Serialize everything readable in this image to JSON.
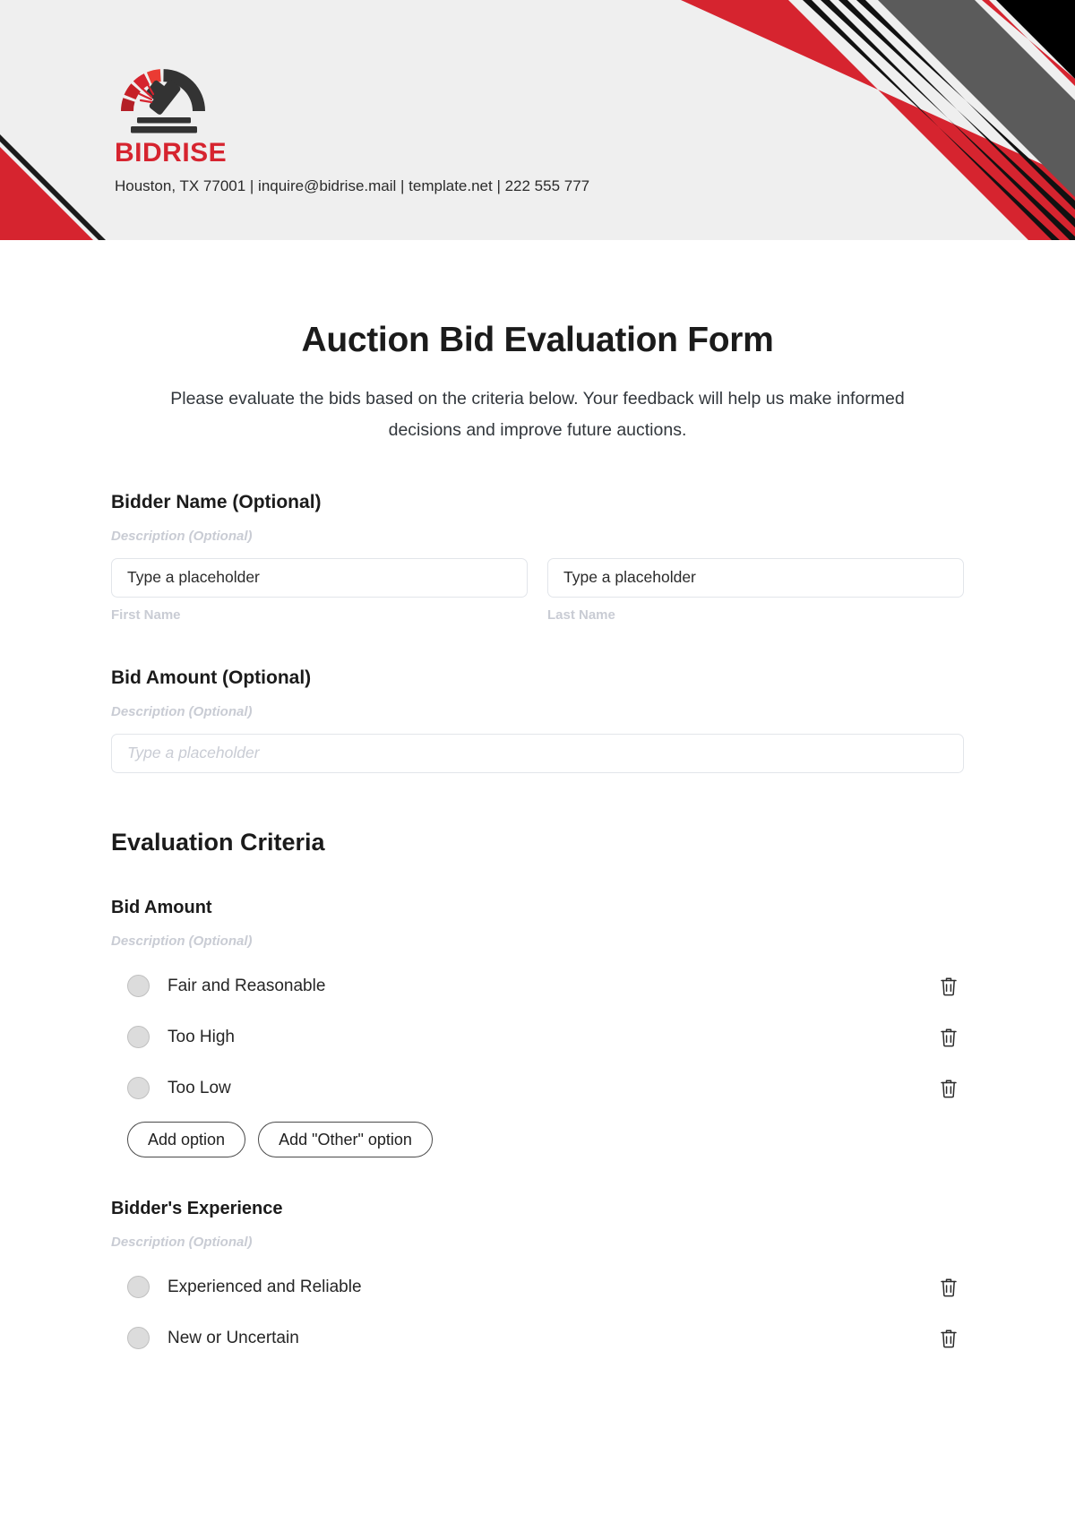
{
  "header": {
    "brand_name": "BIDRISE",
    "contact_line": "Houston, TX 77001 | inquire@bidrise.mail | template.net | 222 555 777",
    "logo_icon": "gavel-arc-icon",
    "colors": {
      "band_bg": "#efefef",
      "red": "#d6242f",
      "dark": "#333333",
      "black": "#000000",
      "gray_stripe": "#5b5b5b"
    }
  },
  "form": {
    "title": "Auction Bid Evaluation Form",
    "description": "Please evaluate the bids based on the criteria below. Your feedback will help us make informed decisions and improve future auctions.",
    "fields": [
      {
        "label": "Bidder Name (Optional)",
        "description": "Description (Optional)",
        "inputs": [
          {
            "value": "Type a placeholder",
            "sub_label": "First Name"
          },
          {
            "value": "Type a placeholder",
            "sub_label": "Last Name"
          }
        ]
      },
      {
        "label": "Bid Amount (Optional)",
        "description": "Description (Optional)",
        "placeholder": "Type a placeholder"
      }
    ],
    "criteria_heading": "Evaluation Criteria",
    "groups": [
      {
        "title": "Bid Amount",
        "description": "Description (Optional)",
        "options": [
          "Fair and Reasonable",
          "Too High",
          "Too Low"
        ],
        "buttons": {
          "add_option": "Add option",
          "add_other": "Add \"Other\" option"
        }
      },
      {
        "title": "Bidder's Experience",
        "description": "Description (Optional)",
        "options": [
          "Experienced and Reliable",
          "New or Uncertain"
        ]
      }
    ],
    "icons": {
      "delete": "trash-icon",
      "radio": "radio-button-icon"
    }
  }
}
